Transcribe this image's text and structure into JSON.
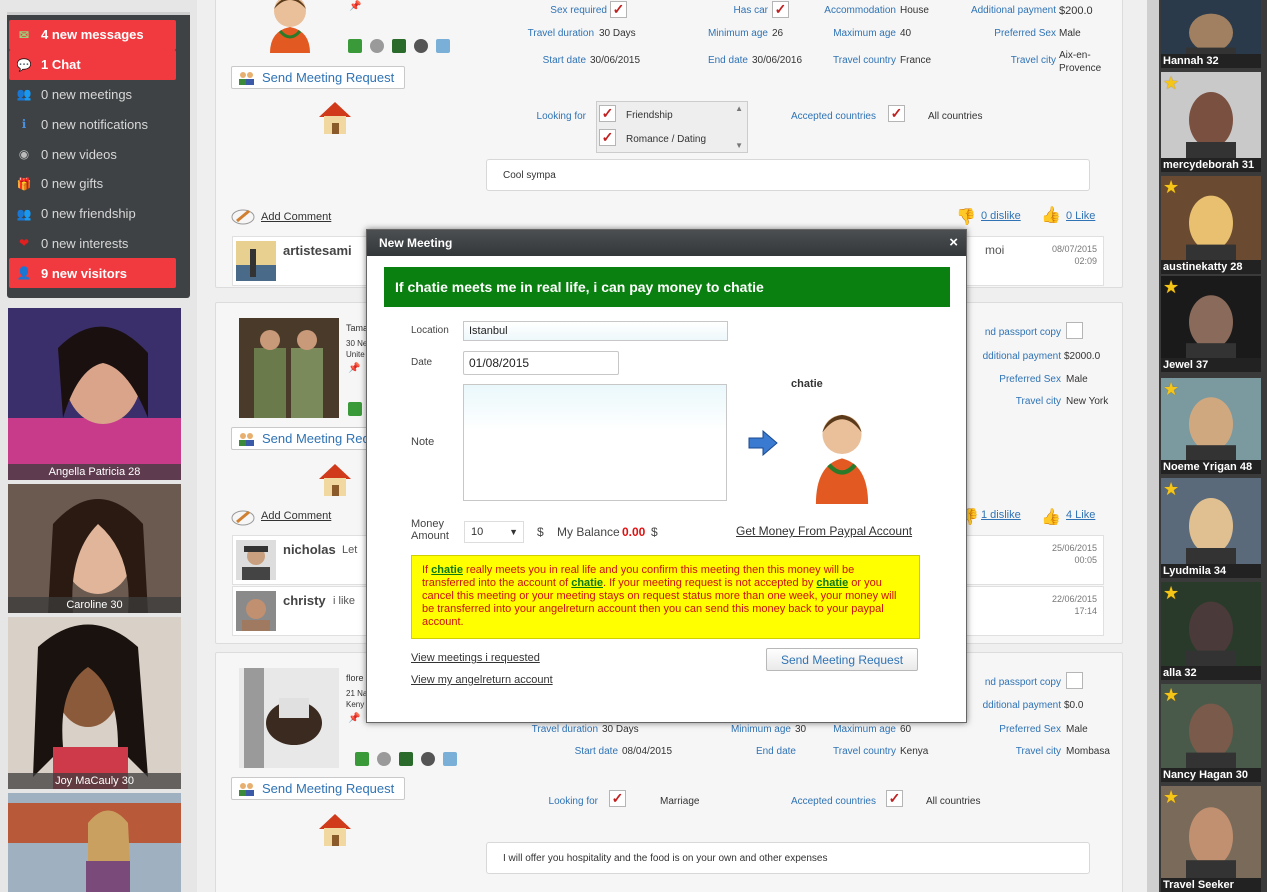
{
  "notifications": [
    {
      "label": "4 new messages",
      "highlight": true,
      "icon": "envelope-icon"
    },
    {
      "label": "1 Chat",
      "highlight": true,
      "icon": "chat-icon"
    },
    {
      "label": "0 new meetings",
      "highlight": false,
      "icon": "people-icon"
    },
    {
      "label": "0 new notifications",
      "highlight": false,
      "icon": "info-icon"
    },
    {
      "label": "0 new videos",
      "highlight": false,
      "icon": "webcam-icon"
    },
    {
      "label": "0 new gifts",
      "highlight": false,
      "icon": "gift-icon"
    },
    {
      "label": "0 new friendship",
      "highlight": false,
      "icon": "friends-icon"
    },
    {
      "label": "0 new interests",
      "highlight": false,
      "icon": "heart-icon"
    },
    {
      "label": "9 new visitors",
      "highlight": true,
      "icon": "visitor-icon"
    }
  ],
  "left_photos": [
    {
      "name": "Angella Patricia 28"
    },
    {
      "name": "Caroline 30"
    },
    {
      "name": "Joy MaCauly 30"
    },
    {
      "name": ""
    }
  ],
  "right_photos": [
    {
      "name": "Hannah 32",
      "star": false
    },
    {
      "name": "mercydeborah 31",
      "star": true
    },
    {
      "name": "austinekatty 28",
      "star": true
    },
    {
      "name": "Jewel 37",
      "star": true
    },
    {
      "name": "Noeme Yrigan 48",
      "star": true
    },
    {
      "name": "Lyudmila 34",
      "star": true
    },
    {
      "name": "alla 32",
      "star": true
    },
    {
      "name": "Nancy Hagan 30",
      "star": true
    },
    {
      "name": "Travel Seeker",
      "star": true
    }
  ],
  "card1": {
    "send_request": "Send Meeting Request",
    "sex_required_label": "Sex required",
    "has_car_label": "Has car",
    "accommodation_label": "Accommodation",
    "accommodation": "House",
    "additional_payment_label": "Additional payment",
    "additional_payment": "$200.0",
    "travel_duration_label": "Travel duration",
    "travel_duration": "30 Days",
    "minimum_age_label": "Minimum age",
    "minimum_age": "26",
    "maximum_age_label": "Maximum age",
    "maximum_age": "40",
    "preferred_sex_label": "Preferred Sex",
    "preferred_sex": "Male",
    "start_date_label": "Start date",
    "start_date": "30/06/2015",
    "end_date_label": "End date",
    "end_date": "30/06/2016",
    "travel_country_label": "Travel country",
    "travel_country": "France",
    "travel_city_label": "Travel city",
    "travel_city": "Aix-en-Provence",
    "looking_for_label": "Looking for",
    "looking_for": [
      "Friendship",
      "Romance / Dating"
    ],
    "accepted_countries_label": "Accepted countries",
    "accepted_countries": "All countries",
    "note": "Cool sympa",
    "add_comment": "Add Comment",
    "dislike": "0 dislike",
    "like": "0 Like",
    "comment": {
      "user": "artistesami",
      "text": "moi",
      "date": "08/07/2015",
      "time": "02:09"
    }
  },
  "card2": {
    "send_request": "Send Meeting Request",
    "name_partial": "Tama",
    "line2_partial": "30 Ne",
    "line3_partial": "Unite",
    "passport_label": "nd passport copy",
    "additional_payment_label": "dditional payment",
    "additional_payment": "$2000.0",
    "preferred_sex_label": "Preferred Sex",
    "preferred_sex": "Male",
    "travel_city_label": "Travel city",
    "travel_city": "New York",
    "add_comment": "Add Comment",
    "dislike": "1 dislike",
    "like": "4 Like",
    "comments": [
      {
        "user": "nicholas",
        "text": "Let",
        "date": "25/06/2015",
        "time": "00:05"
      },
      {
        "user": "christy",
        "text": "i like",
        "date": "22/06/2015",
        "time": "17:14"
      }
    ]
  },
  "card3": {
    "send_request": "Send Meeting Request",
    "name_partial": "flore",
    "line2_partial": "21 Na",
    "line3_partial": "Keny",
    "passport_label": "nd passport copy",
    "additional_payment_label": "dditional payment",
    "additional_payment": "$0.0",
    "travel_duration_label": "Travel duration",
    "travel_duration": "30 Days",
    "minimum_age_label": "Minimum age",
    "minimum_age": "30",
    "maximum_age_label": "Maximum age",
    "maximum_age": "60",
    "preferred_sex_label": "Preferred Sex",
    "preferred_sex": "Male",
    "start_date_label": "Start date",
    "start_date": "08/04/2015",
    "end_date_label": "End date",
    "travel_country_label": "Travel country",
    "travel_country": "Kenya",
    "travel_city_label": "Travel city",
    "travel_city": "Mombasa",
    "looking_for_label": "Looking for",
    "looking_for": "Marriage",
    "accepted_countries_label": "Accepted countries",
    "accepted_countries": "All countries",
    "note": "I will offer you hospitality and the food is on your own and other expenses"
  },
  "modal": {
    "title": "New Meeting",
    "close": "×",
    "headline": "If chatie meets me in real life, i can pay money to chatie",
    "location_label": "Location",
    "location": "Istanbul",
    "date_label": "Date",
    "date": "01/08/2015",
    "note_label": "Note",
    "recipient": "chatie",
    "money_label_1": "Money",
    "money_label_2": "Amount",
    "amount": "10",
    "currency": "$",
    "balance_label": "My Balance",
    "balance": "0.00",
    "balance_currency": "$",
    "paypal_link": "Get Money From Paypal Account",
    "info_prefix": "If ",
    "info_user": "chatie",
    "info_part1": " really meets you in real life and you confirm this meeting then this money will be transferred into the account of ",
    "info_part2": ". If your meeting request is not accepted by ",
    "info_part3": " or you cancel this meeting or your meeting stays on request status more than one week, your money will be transferred into your angelreturn account then you can send this money back to your paypal account.",
    "view_requested": "View meetings i requested",
    "view_account": "View my angelreturn account",
    "send_button": "Send Meeting Request"
  },
  "colors": {
    "accent_red": "#f03a3f",
    "link_blue": "#2f73b5",
    "headline_green": "#0a8010",
    "warning_yellow": "#ffff00"
  }
}
